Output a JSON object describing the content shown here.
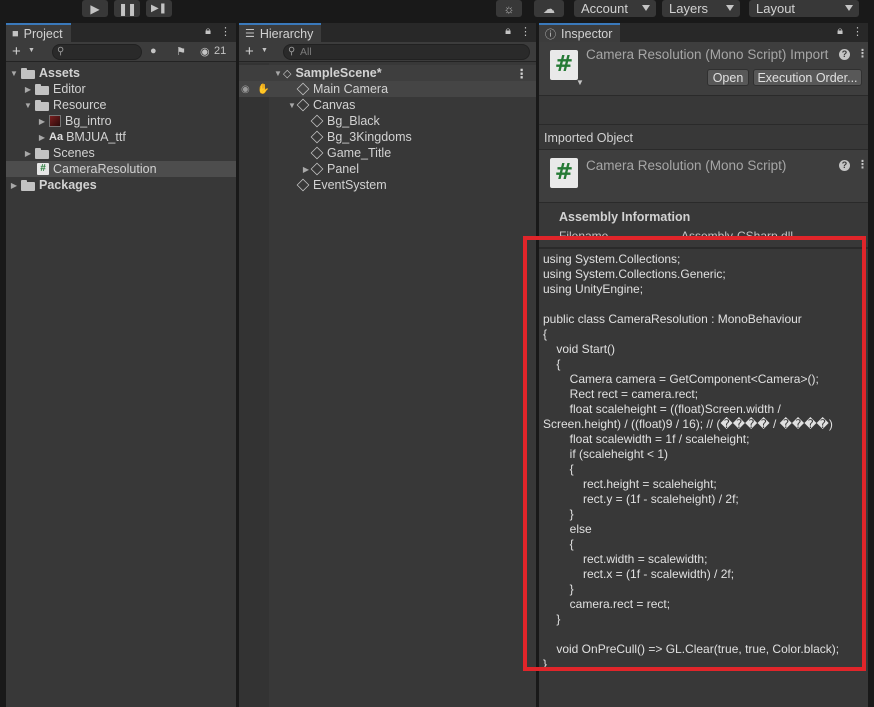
{
  "toolbar": {
    "play_icon": "play-icon",
    "pause_icon": "pause-icon",
    "step_icon": "step-icon",
    "account_label": "Account",
    "layers_label": "Layers",
    "layout_label": "Layout"
  },
  "project": {
    "tab_label": "Project",
    "hidden_count": "21",
    "search_placeholder": "",
    "tree": [
      {
        "label": "Assets"
      },
      {
        "label": "Editor"
      },
      {
        "label": "Resource"
      },
      {
        "label": "Bg_intro"
      },
      {
        "label": "BMJUA_ttf"
      },
      {
        "label": "Scenes"
      },
      {
        "label": "CameraResolution"
      },
      {
        "label": "Packages"
      }
    ]
  },
  "hierarchy": {
    "tab_label": "Hierarchy",
    "search_placeholder": "All",
    "tree": [
      {
        "label": "SampleScene*"
      },
      {
        "label": "Main Camera"
      },
      {
        "label": "Canvas"
      },
      {
        "label": "Bg_Black"
      },
      {
        "label": "Bg_3Kingdoms"
      },
      {
        "label": "Game_Title"
      },
      {
        "label": "Panel"
      },
      {
        "label": "EventSystem"
      }
    ]
  },
  "inspector": {
    "tab_label": "Inspector",
    "header_title": "Camera Resolution (Mono Script) Import",
    "open_label": "Open",
    "exec_order_label": "Execution Order...",
    "imported_object_label": "Imported Object",
    "script_title": "Camera Resolution (Mono Script)",
    "assembly_label": "Assembly Information",
    "filename_label": "Filename",
    "filename_value": "Assembly-CSharp.dll",
    "code": "using System.Collections;\nusing System.Collections.Generic;\nusing UnityEngine;\n\npublic class CameraResolution : MonoBehaviour\n{\n    void Start()\n    {\n        Camera camera = GetComponent<Camera>();\n        Rect rect = camera.rect;\n        float scaleheight = ((float)Screen.width /\nScreen.height) / ((float)9 / 16); // (���� / ����)\n        float scalewidth = 1f / scaleheight;\n        if (scaleheight < 1)\n        {\n            rect.height = scaleheight;\n            rect.y = (1f - scaleheight) / 2f;\n        }\n        else\n        {\n            rect.width = scalewidth;\n            rect.x = (1f - scalewidth) / 2f;\n        }\n        camera.rect = rect;\n    }\n\n    void OnPreCull() => GL.Clear(true, true, Color.black);\n}"
  },
  "colors": {
    "highlight_border": "#e0252a",
    "tab_accent": "#3a79bb",
    "panel_bg": "#383838"
  }
}
